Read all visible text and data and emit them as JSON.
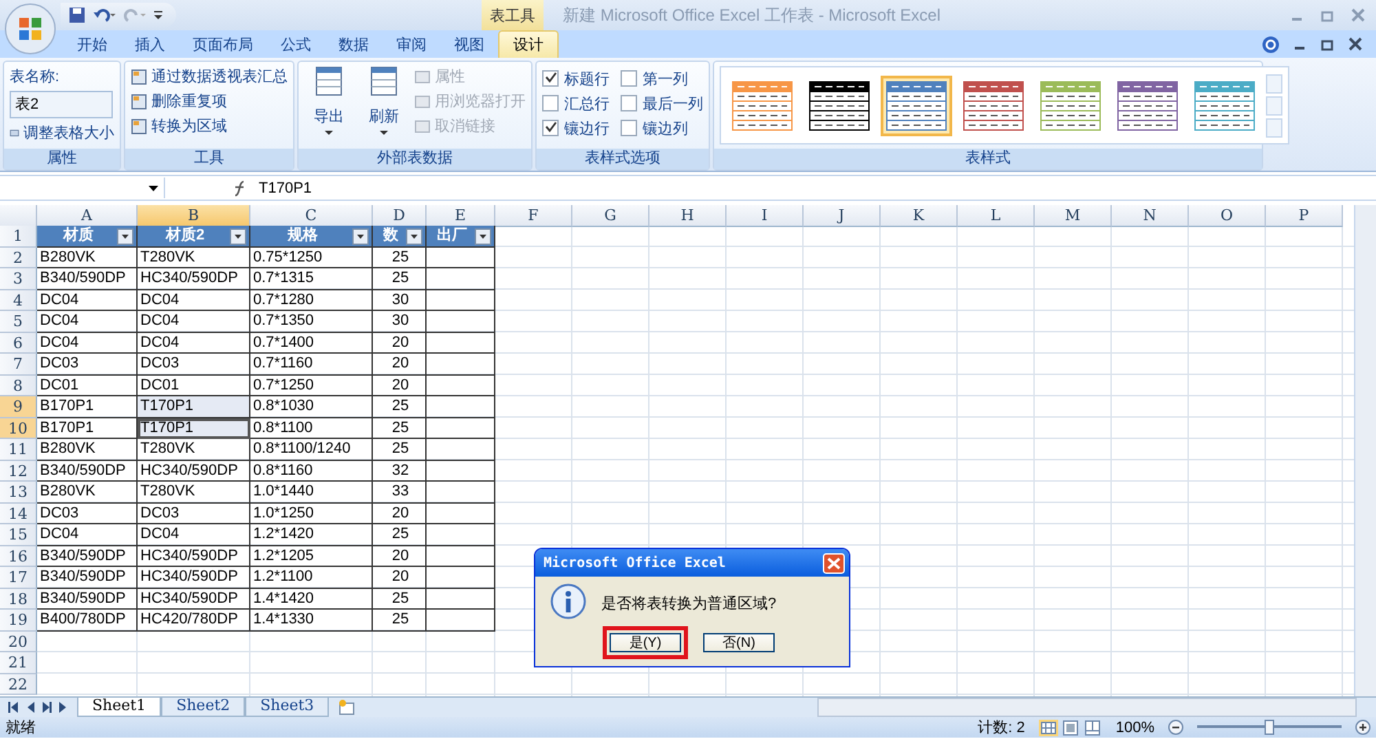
{
  "window": {
    "title": "新建 Microsoft Office Excel 工作表 - Microsoft Excel",
    "context_group": "表工具"
  },
  "menu_tabs": [
    {
      "label": "开始",
      "selected": false
    },
    {
      "label": "插入",
      "selected": false
    },
    {
      "label": "页面布局",
      "selected": false
    },
    {
      "label": "公式",
      "selected": false
    },
    {
      "label": "数据",
      "selected": false
    },
    {
      "label": "审阅",
      "selected": false
    },
    {
      "label": "视图",
      "selected": false
    },
    {
      "label": "设计",
      "selected": true
    }
  ],
  "properties_group": {
    "label": "属性",
    "name_label": "表名称:",
    "name_value": "表2",
    "resize": "调整表格大小"
  },
  "tools_group": {
    "label": "工具",
    "items": [
      "通过数据透视表汇总",
      "删除重复项",
      "转换为区域"
    ]
  },
  "external_group": {
    "label": "外部表数据",
    "big_buttons": [
      "导出",
      "刷新"
    ],
    "items": [
      {
        "label": "属性",
        "disabled": true
      },
      {
        "label": "用浏览器打开",
        "disabled": true
      },
      {
        "label": "取消链接",
        "disabled": true
      }
    ]
  },
  "style_options": {
    "label": "表样式选项",
    "options": [
      {
        "label": "标题行",
        "checked": true
      },
      {
        "label": "汇总行",
        "checked": false
      },
      {
        "label": "镶边行",
        "checked": true
      },
      {
        "label": "第一列",
        "checked": false
      },
      {
        "label": "最后一列",
        "checked": false
      },
      {
        "label": "镶边列",
        "checked": false
      }
    ]
  },
  "table_styles": {
    "label": "表样式",
    "styles": [
      {
        "color": "#f79646",
        "selected": false
      },
      {
        "color": "#000000",
        "selected": false
      },
      {
        "color": "#4f81bd",
        "selected": true
      },
      {
        "color": "#c0504d",
        "selected": false
      },
      {
        "color": "#9bbb59",
        "selected": false
      },
      {
        "color": "#8064a2",
        "selected": false
      },
      {
        "color": "#4bacc6",
        "selected": false
      }
    ]
  },
  "formula_bar": {
    "formula": "T170P1"
  },
  "sheet": {
    "columns": [
      {
        "label": "A",
        "selected": false
      },
      {
        "label": "B",
        "selected": true
      },
      {
        "label": "C",
        "selected": false
      },
      {
        "label": "D",
        "selected": false
      },
      {
        "label": "E",
        "selected": false
      },
      {
        "label": "F",
        "selected": false
      },
      {
        "label": "G",
        "selected": false
      },
      {
        "label": "H",
        "selected": false
      },
      {
        "label": "I",
        "selected": false
      },
      {
        "label": "J",
        "selected": false
      },
      {
        "label": "K",
        "selected": false
      },
      {
        "label": "L",
        "selected": false
      },
      {
        "label": "M",
        "selected": false
      },
      {
        "label": "N",
        "selected": false
      },
      {
        "label": "O",
        "selected": false
      },
      {
        "label": "P",
        "selected": false
      }
    ],
    "rows": [
      {
        "number": "1",
        "kind": "header",
        "selected": false,
        "cells": [
          "材质",
          "材质2",
          "规格",
          "数",
          "出厂"
        ]
      },
      {
        "number": "2",
        "kind": "data",
        "selected": false,
        "cells": [
          "B280VK",
          "T280VK",
          "0.75*1250",
          "25"
        ]
      },
      {
        "number": "3",
        "kind": "data",
        "selected": false,
        "cells": [
          "B340/590DP",
          "HC340/590DP",
          "0.7*1315",
          "25"
        ]
      },
      {
        "number": "4",
        "kind": "data",
        "selected": false,
        "cells": [
          "DC04",
          "DC04",
          "0.7*1280",
          "30"
        ]
      },
      {
        "number": "5",
        "kind": "data",
        "selected": false,
        "cells": [
          "DC04",
          "DC04",
          "0.7*1350",
          "30"
        ]
      },
      {
        "number": "6",
        "kind": "data",
        "selected": false,
        "cells": [
          "DC04",
          "DC04",
          "0.7*1400",
          "20"
        ]
      },
      {
        "number": "7",
        "kind": "data",
        "selected": false,
        "cells": [
          "DC03",
          "DC03",
          "0.7*1160",
          "20"
        ]
      },
      {
        "number": "8",
        "kind": "data",
        "selected": false,
        "cells": [
          "DC01",
          "DC01",
          "0.7*1250",
          "20"
        ]
      },
      {
        "number": "9",
        "kind": "data",
        "selected": true,
        "cells": [
          "B170P1",
          "T170P1",
          "0.8*1030",
          "25"
        ]
      },
      {
        "number": "10",
        "kind": "data",
        "selected": true,
        "cells": [
          "B170P1",
          "T170P1",
          "0.8*1100",
          "25"
        ]
      },
      {
        "number": "11",
        "kind": "data",
        "selected": false,
        "cells": [
          "B280VK",
          "T280VK",
          "0.8*1100/1240",
          "25"
        ]
      },
      {
        "number": "12",
        "kind": "data",
        "selected": false,
        "cells": [
          "B340/590DP",
          "HC340/590DP",
          "0.8*1160",
          "32"
        ]
      },
      {
        "number": "13",
        "kind": "data",
        "selected": false,
        "cells": [
          "B280VK",
          "T280VK",
          "1.0*1440",
          "33"
        ]
      },
      {
        "number": "14",
        "kind": "data",
        "selected": false,
        "cells": [
          "DC03",
          "DC03",
          "1.0*1250",
          "20"
        ]
      },
      {
        "number": "15",
        "kind": "data",
        "selected": false,
        "cells": [
          "DC04",
          "DC04",
          "1.2*1420",
          "25"
        ]
      },
      {
        "number": "16",
        "kind": "data",
        "selected": false,
        "cells": [
          "B340/590DP",
          "HC340/590DP",
          "1.2*1205",
          "20"
        ]
      },
      {
        "number": "17",
        "kind": "data",
        "selected": false,
        "cells": [
          "B340/590DP",
          "HC340/590DP",
          "1.2*1100",
          "20"
        ]
      },
      {
        "number": "18",
        "kind": "data",
        "selected": false,
        "cells": [
          "B340/590DP",
          "HC340/590DP",
          "1.4*1420",
          "25"
        ]
      },
      {
        "number": "19",
        "kind": "data",
        "selected": false,
        "cells": [
          "B400/780DP",
          "HC420/780DP",
          "1.4*1330",
          "25"
        ]
      },
      {
        "number": "20",
        "kind": "empty",
        "selected": false
      },
      {
        "number": "21",
        "kind": "empty",
        "selected": false
      },
      {
        "number": "22",
        "kind": "empty",
        "selected": false
      }
    ]
  },
  "sheet_tabs": [
    {
      "label": "Sheet1",
      "selected": true
    },
    {
      "label": "Sheet2",
      "selected": false
    },
    {
      "label": "Sheet3",
      "selected": false
    }
  ],
  "status_bar": {
    "ready": "就绪",
    "count": "计数: 2",
    "zoom": "100%",
    "zoom_slider": {
      "level": 0.5
    }
  },
  "dialog": {
    "title": "Microsoft Office Excel",
    "message": "是否将表转换为普通区域?",
    "buttons": [
      {
        "label": "是(Y)",
        "highlighted": true
      },
      {
        "label": "否(N)",
        "highlighted": false
      }
    ]
  }
}
